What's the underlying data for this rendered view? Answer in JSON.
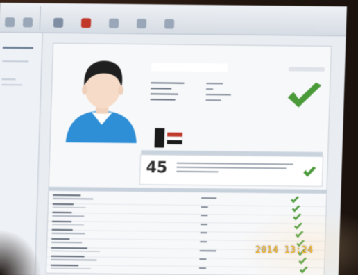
{
  "score": {
    "value": "45"
  },
  "timestamp": "2014 13:24",
  "colors": {
    "check_green": "#4a9a3a",
    "avatar_blue": "#2f8fd6",
    "timestamp_orange": "#f0b93a"
  }
}
